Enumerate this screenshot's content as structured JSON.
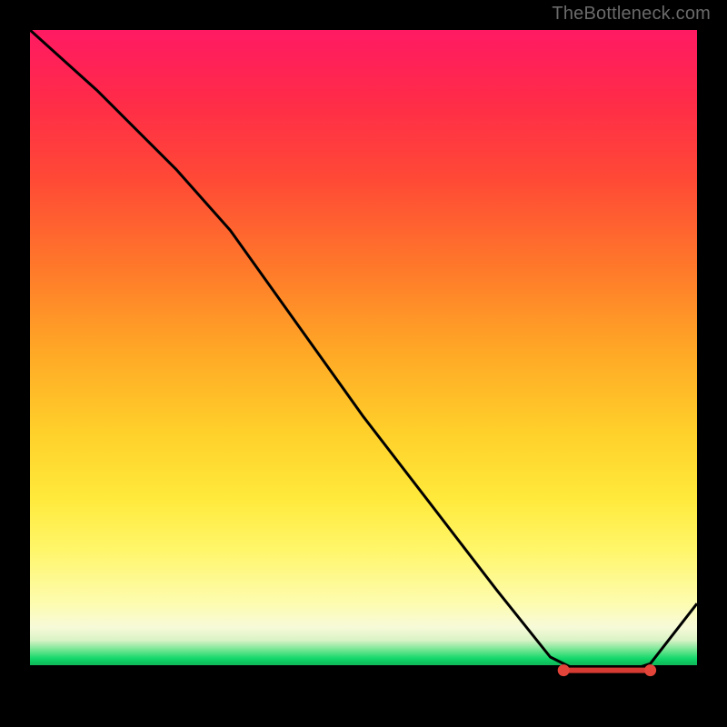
{
  "watermark": "TheBottleneck.com",
  "chart_data": {
    "type": "line",
    "title": "",
    "xlabel": "",
    "ylabel": "",
    "xlim": [
      0,
      100
    ],
    "ylim": [
      0,
      100
    ],
    "grid": false,
    "legend": false,
    "series": [
      {
        "name": "curve",
        "x": [
          0,
          10,
          22,
          30,
          40,
          50,
          60,
          70,
          78,
          82,
          86,
          90,
          93,
          100
        ],
        "values": [
          100,
          91,
          79,
          70,
          56,
          42,
          29,
          16,
          6,
          4,
          4,
          4,
          5,
          14
        ]
      }
    ],
    "optimum_band": {
      "x_start": 80,
      "x_end": 93,
      "y": 4
    },
    "markers": [
      {
        "x": 80,
        "y": 4
      },
      {
        "x": 93,
        "y": 4
      }
    ]
  }
}
